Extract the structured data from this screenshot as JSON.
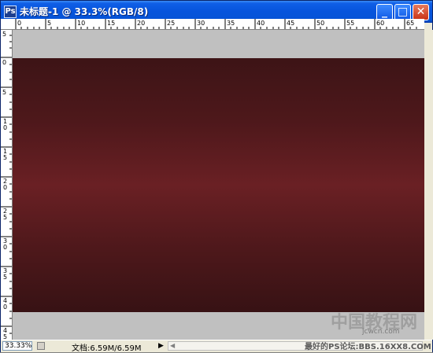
{
  "window": {
    "title": "未标题-1 @ 33.3%(RGB/8)",
    "buttons": {
      "minimize": "_",
      "maximize": "□",
      "close": "✕"
    },
    "icon": "photoshop-document-icon"
  },
  "rulers": {
    "top_labels": [
      "0",
      "5",
      "10",
      "15",
      "20",
      "25",
      "30",
      "35",
      "40",
      "45",
      "50",
      "55",
      "60",
      "65"
    ],
    "left_labels": [
      "5",
      "0",
      "5",
      "1\n0",
      "1\n5",
      "2\n0",
      "2\n5",
      "3\n0",
      "3\n5",
      "4\n0",
      "4\n5"
    ]
  },
  "statusbar": {
    "zoom": "33.33%",
    "doc_info": "文档:6.59M/6.59M",
    "arrow": "▶",
    "scroll_left": "◀"
  },
  "watermark": {
    "main": "中国教程网",
    "url": "jcwcn.com",
    "sub": "最好的PS论坛:BBS.16XX8.COM"
  },
  "colors": {
    "titlebar": "#0654dc",
    "canvas_bg": "#c0c0c0",
    "doc_center": "#6a2024",
    "doc_edge": "#3d1416"
  }
}
